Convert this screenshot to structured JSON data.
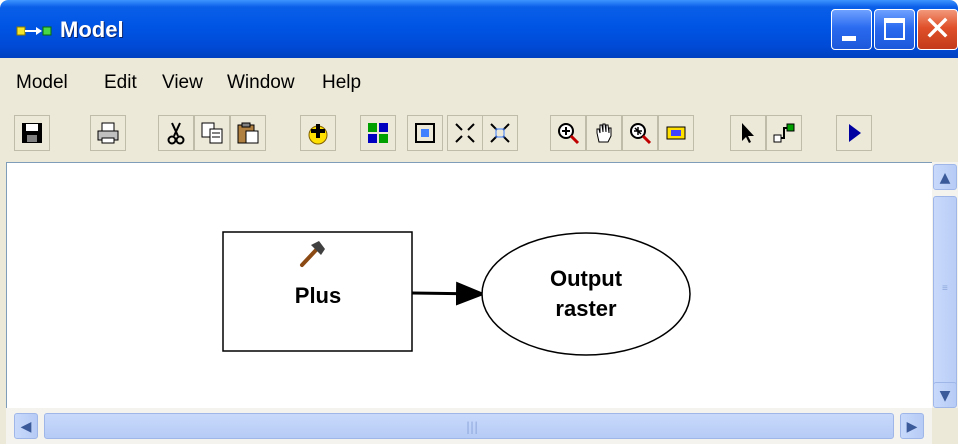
{
  "window": {
    "title": "Model",
    "controls": [
      "minimize",
      "maximize",
      "close"
    ]
  },
  "menu": {
    "items": [
      "Model",
      "Edit",
      "View",
      "Window",
      "Help"
    ]
  },
  "toolbar": {
    "buttons": [
      {
        "name": "save",
        "icon": "save-icon"
      },
      {
        "name": "print",
        "icon": "print-icon"
      },
      {
        "name": "cut",
        "icon": "cut-icon"
      },
      {
        "name": "copy",
        "icon": "copy-icon"
      },
      {
        "name": "paste",
        "icon": "paste-icon"
      },
      {
        "name": "add-data",
        "icon": "add-data-icon"
      },
      {
        "name": "auto-layout",
        "icon": "layout-icon"
      },
      {
        "name": "full-extent",
        "icon": "full-extent-icon"
      },
      {
        "name": "fixed-zoom-in",
        "icon": "fixed-zoom-in-icon"
      },
      {
        "name": "fixed-zoom-out",
        "icon": "fixed-zoom-out-icon"
      },
      {
        "name": "zoom-in",
        "icon": "zoom-in-icon"
      },
      {
        "name": "pan",
        "icon": "pan-hand-icon"
      },
      {
        "name": "zoom-out",
        "icon": "zoom-out-icon"
      },
      {
        "name": "overview",
        "icon": "overview-icon"
      },
      {
        "name": "select",
        "icon": "arrow-pointer-icon"
      },
      {
        "name": "connect",
        "icon": "connect-icon"
      },
      {
        "name": "run",
        "icon": "run-icon"
      }
    ]
  },
  "diagram": {
    "tool_node": {
      "label": "Plus",
      "icon": "hammer-icon"
    },
    "data_node": {
      "label_line1": "Output",
      "label_line2": "raster"
    }
  },
  "colors": {
    "titlebar": "#0055e5",
    "window_bg": "#ece9d8",
    "close_button": "#e0502a"
  }
}
